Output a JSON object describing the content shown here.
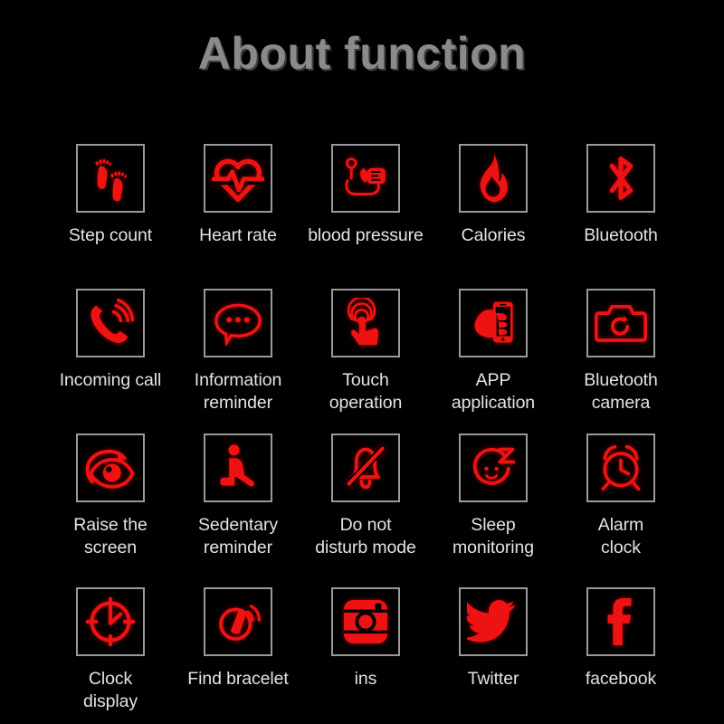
{
  "header": {
    "title": "About function",
    "title_color": "#8a8a8a"
  },
  "theme": {
    "background": "#000000",
    "icon_color": "#ef1212",
    "box_border": "#9a9a9a",
    "label_color": "#e3e3e3"
  },
  "grid": {
    "columns": 5,
    "rows": 4,
    "items": [
      {
        "id": 1,
        "label": "Step count",
        "icon": "footprints-icon"
      },
      {
        "id": 2,
        "label": "Heart rate",
        "icon": "heart-pulse-icon"
      },
      {
        "id": 3,
        "label": "blood pressure",
        "icon": "blood-pressure-monitor-icon"
      },
      {
        "id": 4,
        "label": "Calories",
        "icon": "flame-icon"
      },
      {
        "id": 5,
        "label": "Bluetooth",
        "icon": "bluetooth-icon"
      },
      {
        "id": 6,
        "label": "Incoming call",
        "icon": "ringing-phone-icon"
      },
      {
        "id": 7,
        "label": "Information\nreminder",
        "icon": "speech-bubble-icon"
      },
      {
        "id": 8,
        "label": "Touch\noperation",
        "icon": "touch-hand-icon"
      },
      {
        "id": 9,
        "label": "APP\napplication",
        "icon": "hand-holding-phone-icon"
      },
      {
        "id": 10,
        "label": "Bluetooth\ncamera",
        "icon": "camera-icon"
      },
      {
        "id": 11,
        "label": "Raise the\nscreen",
        "icon": "eye-rotate-icon"
      },
      {
        "id": 12,
        "label": "Sedentary\nreminder",
        "icon": "person-sitting-icon"
      },
      {
        "id": 13,
        "label": "Do not\ndisturb mode",
        "icon": "bell-slash-icon"
      },
      {
        "id": 14,
        "label": "Sleep\nmonitoring",
        "icon": "sleeping-face-icon"
      },
      {
        "id": 15,
        "label": "Alarm\nclock",
        "icon": "alarm-clock-icon"
      },
      {
        "id": 16,
        "label": "Clock\ndisplay",
        "icon": "clock-face-icon"
      },
      {
        "id": 17,
        "label": "Find bracelet",
        "icon": "bracelet-signal-icon"
      },
      {
        "id": 18,
        "label": "ins",
        "icon": "instagram-icon"
      },
      {
        "id": 19,
        "label": "Twitter",
        "icon": "twitter-bird-icon"
      },
      {
        "id": 20,
        "label": "facebook",
        "icon": "facebook-f-icon"
      }
    ]
  }
}
